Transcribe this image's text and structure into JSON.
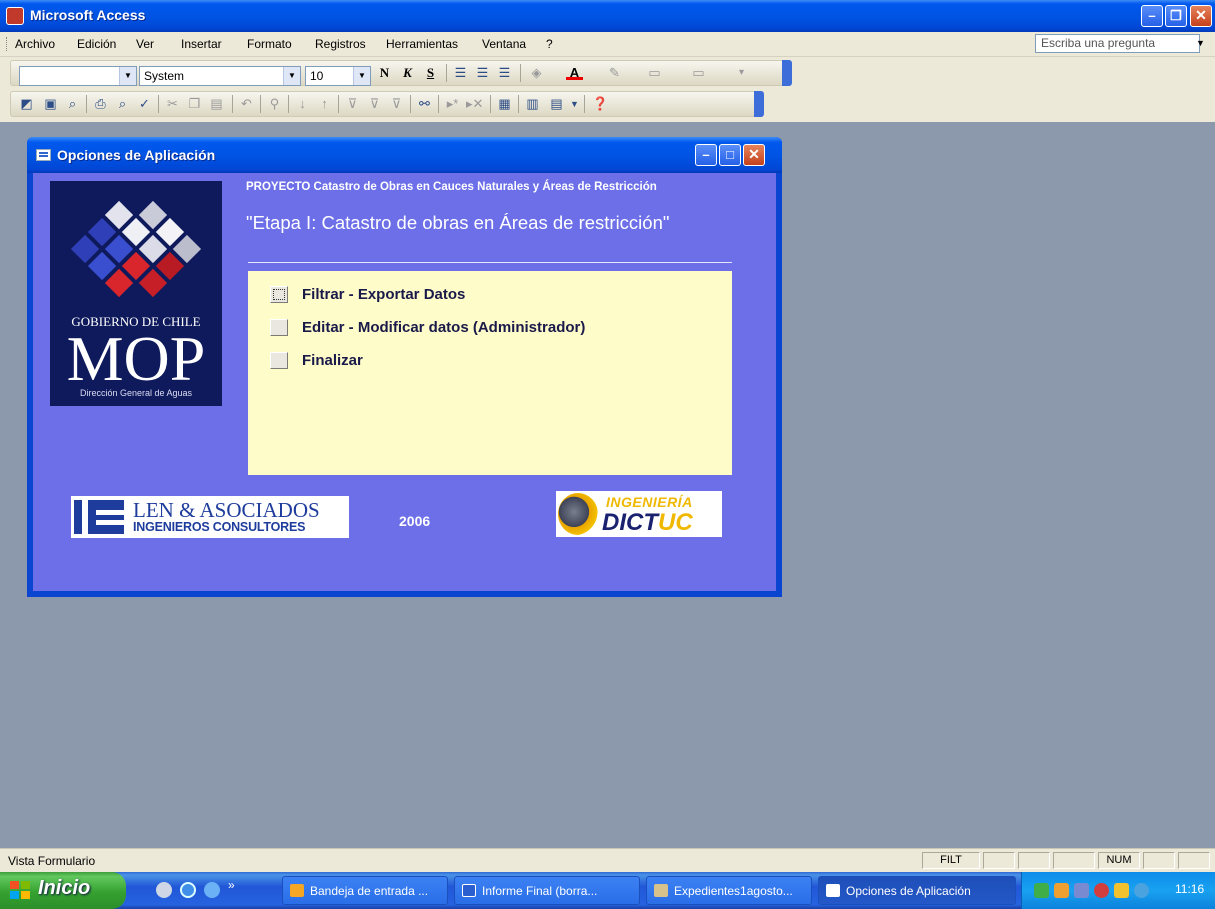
{
  "app": {
    "title": "Microsoft Access"
  },
  "menu": {
    "items": [
      "Archivo",
      "Edición",
      "Ver",
      "Insertar",
      "Formato",
      "Registros",
      "Herramientas",
      "Ventana",
      "?"
    ],
    "ask_placeholder": "Escriba una pregunta"
  },
  "format_toolbar": {
    "object_combo": "",
    "font_name": "System",
    "font_size": "10",
    "bold_label": "N",
    "italic_label": "K",
    "underline_label": "S"
  },
  "form": {
    "title": "Opciones de Aplicación",
    "project_line": "PROYECTO Catastro de Obras en Cauces Naturales y Áreas de Restricción",
    "stage_title": "\"Etapa I: Catastro de obras en Áreas de restricción\"",
    "options": [
      {
        "label": "Filtrar - Exportar Datos"
      },
      {
        "label": "Editar - Modificar datos (Administrador)"
      },
      {
        "label": "Finalizar"
      }
    ],
    "year": "2006",
    "logo_mop": {
      "line1": "GOBIERNO DE CHILE",
      "line2": "MOP",
      "line3": "Dirección General de Aguas"
    },
    "logo_len": {
      "name": "LEN & ASOCIADOS",
      "sub": "INGENIEROS CONSULTORES"
    },
    "logo_dictuc": {
      "top": "INGENIERÍA",
      "brand_a": "DICT",
      "brand_b": "UC"
    }
  },
  "statusbar": {
    "text": "Vista Formulario",
    "filt": "FILT",
    "num": "NUM"
  },
  "taskbar": {
    "start_label": "Inicio",
    "tasks": [
      {
        "label": "Bandeja de entrada ..."
      },
      {
        "label": "Informe Final (borra..."
      },
      {
        "label": "Expedientes1agosto..."
      },
      {
        "label": "Opciones de Aplicación"
      }
    ],
    "clock": "11:16"
  },
  "colors": {
    "form_background": "#6c6fe8",
    "menu_panel": "#fefcc9",
    "desktop": "#8c98ab"
  }
}
